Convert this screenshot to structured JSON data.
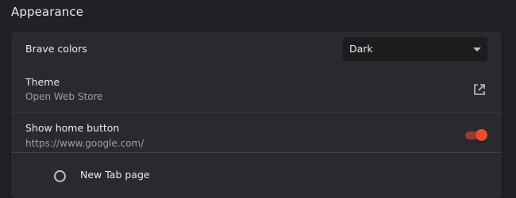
{
  "section": {
    "title": "Appearance"
  },
  "brave_colors": {
    "label": "Brave colors",
    "selected": "Dark"
  },
  "theme": {
    "label": "Theme",
    "sublabel": "Open Web Store",
    "icon": "open-in-new-icon"
  },
  "home_button": {
    "label": "Show home button",
    "sublabel": "https://www.google.com/",
    "enabled": true,
    "accent_color": "#f04a2c"
  },
  "home_options": [
    {
      "label": "New Tab page",
      "selected": false
    }
  ]
}
